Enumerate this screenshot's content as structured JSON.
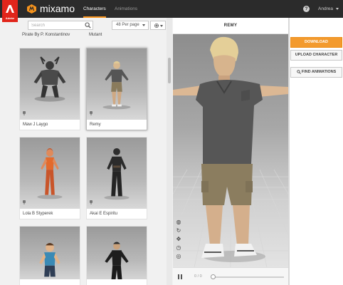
{
  "branding": {
    "adobe_text": "Adobe",
    "app_name": "mixamo",
    "accent_color": "#f7941d"
  },
  "nav": {
    "tabs": [
      {
        "label": "Characters",
        "active": true
      },
      {
        "label": "Animations",
        "active": false
      }
    ],
    "help_icon": "?",
    "user_name": "Andrea"
  },
  "library": {
    "search_placeholder": "Search",
    "per_page": "48 Per page",
    "partial_row_labels": [
      "Pirate By P. Konstantinov",
      "Mutant"
    ],
    "cards": [
      {
        "name": "Maw J Laygo",
        "selected": false,
        "figure": "maw"
      },
      {
        "name": "Remy",
        "selected": true,
        "figure": "remy"
      },
      {
        "name": "Lola B Styperek",
        "selected": false,
        "figure": "lola"
      },
      {
        "name": "Akai E Espiritu",
        "selected": false,
        "figure": "akai"
      },
      {
        "name": "",
        "selected": false,
        "figure": "kid"
      },
      {
        "name": "",
        "selected": false,
        "figure": "suit"
      }
    ]
  },
  "viewer": {
    "title": "REMY",
    "frame_counter": "0 / 0",
    "playback_progress": 0.0
  },
  "actions": {
    "download_label": "DOWNLOAD",
    "upload_label": "UPLOAD CHARACTER",
    "find_animations_label": "FIND ANIMATIONS"
  }
}
